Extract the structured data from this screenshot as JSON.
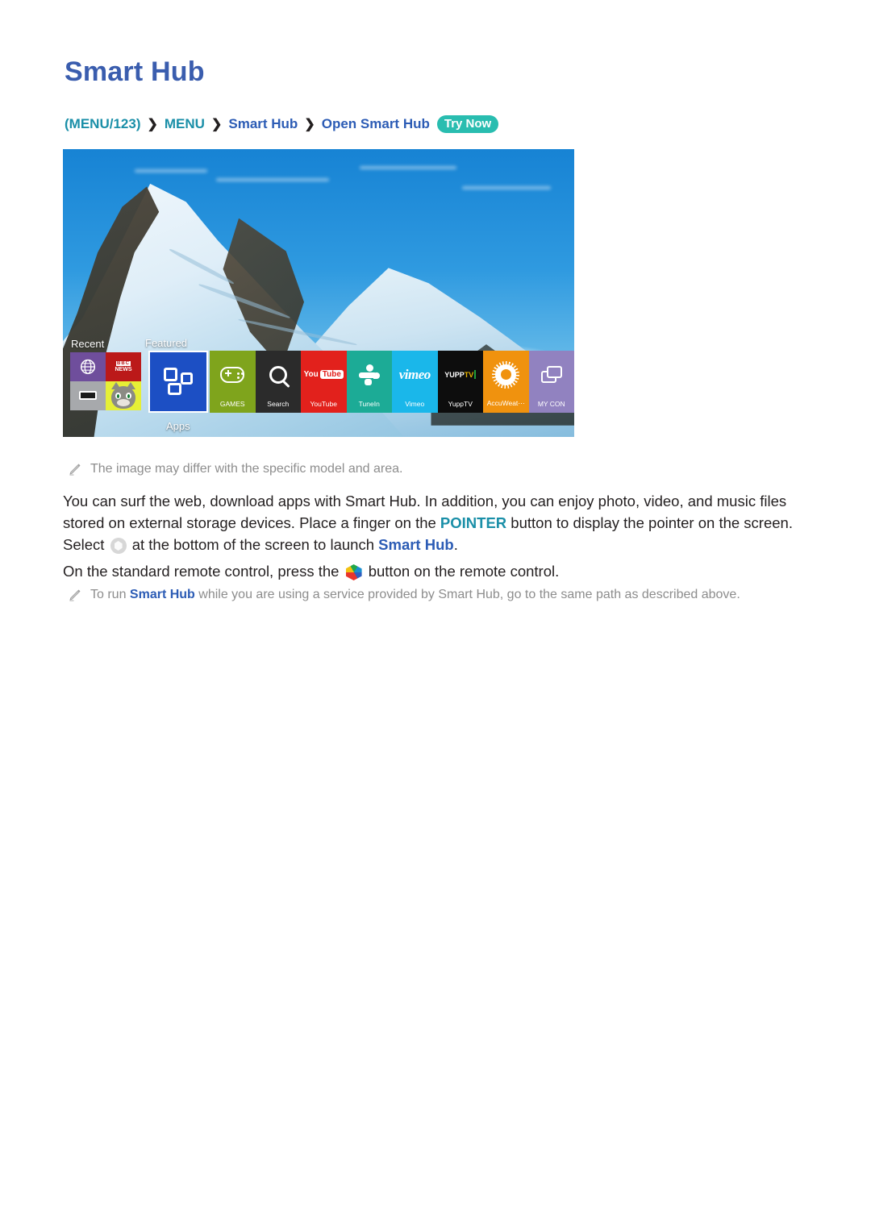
{
  "page": {
    "title": "Smart Hub"
  },
  "breadcrumb": {
    "open_paren": "(",
    "menu123": "MENU/123",
    "close_paren": ")",
    "separator": "❯",
    "item_menu": "MENU",
    "item_smart_hub": "Smart Hub",
    "item_open_smart_hub": "Open Smart Hub",
    "try_now": "Try Now",
    "accent_teal": "#1a8fa8",
    "accent_blue": "#2c5cb5",
    "badge_color": "#29bdb0"
  },
  "tv_screenshot": {
    "sections": {
      "recent_label": "Recent",
      "featured_label": "Featured",
      "apps_label": "Apps"
    },
    "recent_tiles": [
      {
        "name": "web-browser",
        "icon": "globe-icon",
        "color": "#6f4e9c"
      },
      {
        "name": "bbc-news",
        "line1": "BBC",
        "line2": "NEWS",
        "color": "#bb1919"
      },
      {
        "name": "source-device",
        "icon": "hdmi-icon",
        "color": "#a7a9ac"
      },
      {
        "name": "talking-tom",
        "icon": "cat-icon",
        "color": "#e6ef36"
      }
    ],
    "featured_tile": {
      "label": "Apps",
      "color": "#1c4fc4",
      "icon": "apps-blocks-icon"
    },
    "app_tiles": [
      {
        "label": "GAMES",
        "icon": "gamepad-icon",
        "color": "#7fa41c"
      },
      {
        "label": "Search",
        "icon": "magnifier-icon",
        "color": "#2b2b2b"
      },
      {
        "label": "YouTube",
        "icon": "youtube-icon",
        "color": "#e2211c"
      },
      {
        "label": "TuneIn",
        "icon": "tunein-icon",
        "color": "#1cab96"
      },
      {
        "label": "Vimeo",
        "icon": "vimeo-icon",
        "color": "#1ab7ea"
      },
      {
        "label": "YuppTV",
        "icon": "yupptv-icon",
        "color": "#0d0d0d"
      },
      {
        "label": "AccuWeat⋯",
        "icon": "sun-icon",
        "color": "#f0920e"
      },
      {
        "label": "MY CON",
        "icon": "folder-icon",
        "color": "#9182c0"
      }
    ],
    "youtube_logo": {
      "you": "You",
      "tube": "Tube"
    },
    "vimeo_logo": "vimeo",
    "yupptv_logo": {
      "yupp": "YUPP",
      "tv": "TV"
    }
  },
  "notes": {
    "note_image_differ": "The image may differ with the specific model and area.",
    "note_run_prefix": "To run ",
    "note_run_link": "Smart Hub",
    "note_run_suffix": " while you are using a service provided by Smart Hub, go to the same path as described above."
  },
  "body": {
    "para1_a": "You can surf the web, download apps with Smart Hub. In addition, you can enjoy photo, video, and music files stored on external storage devices. Place a finger on the ",
    "para1_pointer": "POINTER",
    "para1_b": " button to display the pointer on the screen. Select ",
    "para1_c": " at the bottom of the screen to launch ",
    "para1_smarthub": "Smart Hub",
    "para1_d": ".",
    "para2_a": "On the standard remote control, press the ",
    "para2_b": " button on the remote control."
  }
}
